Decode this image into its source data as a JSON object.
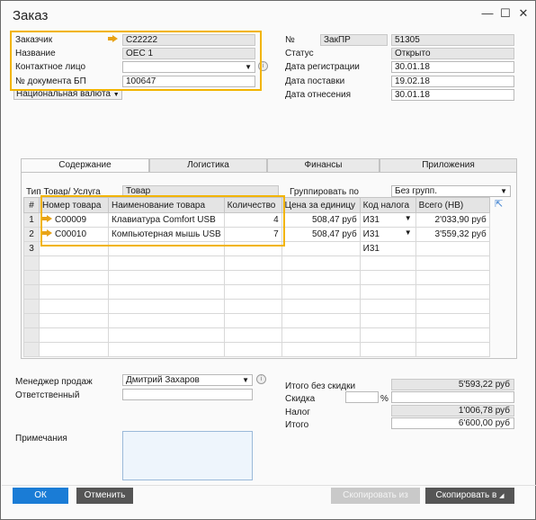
{
  "window": {
    "title": "Заказ",
    "controls": {
      "close": "✕",
      "minimize": "—",
      "maximize": "☐"
    }
  },
  "header_left": {
    "customer": {
      "label": "Заказчик",
      "value": "C22222"
    },
    "name": {
      "label": "Название",
      "value": "OEC 1"
    },
    "contact": {
      "label": "Контактное лицо",
      "value": ""
    },
    "bp_doc": {
      "label": "№ документа БП",
      "value": "100647"
    },
    "currency": {
      "label": "Национальная валюта"
    }
  },
  "header_right": {
    "number": {
      "label": "№",
      "series": "ЗакПР",
      "value": "51305"
    },
    "status": {
      "label": "Статус",
      "value": "Открыто"
    },
    "reg_date": {
      "label": "Дата регистрации",
      "value": "30.01.18"
    },
    "delivery_date": {
      "label": "Дата поставки",
      "value": "19.02.18"
    },
    "posting_date": {
      "label": "Дата отнесения",
      "value": "30.01.18"
    }
  },
  "tabs": [
    "Содержание",
    "Логистика",
    "Финансы",
    "Приложения"
  ],
  "content": {
    "item_type_label": "Тип Товар/ Услуга",
    "item_type_value": "Товар",
    "group_label": "Группировать по",
    "group_value": "Без групп."
  },
  "table": {
    "columns": [
      "#",
      "Номер товара",
      "Наименование товара",
      "Количество",
      "Цена за единицу",
      "Код налога",
      "Всего (НВ)"
    ],
    "rows": [
      {
        "n": "1",
        "item": "C00009",
        "name": "Клавиатура Comfort USB",
        "qty": "4",
        "price": "508,47 руб",
        "tax": "И31",
        "total": "2'033,90 руб"
      },
      {
        "n": "2",
        "item": "C00010",
        "name": "Компьютерная мышь USB",
        "qty": "7",
        "price": "508,47 руб",
        "tax": "И31",
        "total": "3'559,32 руб"
      },
      {
        "n": "3",
        "item": "",
        "name": "",
        "qty": "",
        "price": "",
        "tax": "И31",
        "total": ""
      }
    ]
  },
  "footer_left": {
    "sales_manager": {
      "label": "Менеджер продаж",
      "value": "Дмитрий Захаров"
    },
    "responsible": {
      "label": "Ответственный",
      "value": ""
    },
    "remarks": {
      "label": "Примечания",
      "value": ""
    }
  },
  "totals": {
    "before_discount": {
      "label": "Итого без скидки",
      "value": "5'593,22 руб"
    },
    "discount": {
      "label": "Скидка",
      "pct_sign": "%",
      "value": ""
    },
    "tax": {
      "label": "Налог",
      "value": "1'006,78 руб"
    },
    "total": {
      "label": "Итого",
      "value": "6'600,00 руб"
    }
  },
  "buttons": {
    "ok": "ОК",
    "cancel": "Отменить",
    "copy_from": "Скопировать из",
    "copy_to": "Скопировать в"
  },
  "colors": {
    "highlight": "#f2b400",
    "link_arrow": "#e8a316",
    "ok_button": "#1a7cd6",
    "dark_button": "#555555"
  }
}
